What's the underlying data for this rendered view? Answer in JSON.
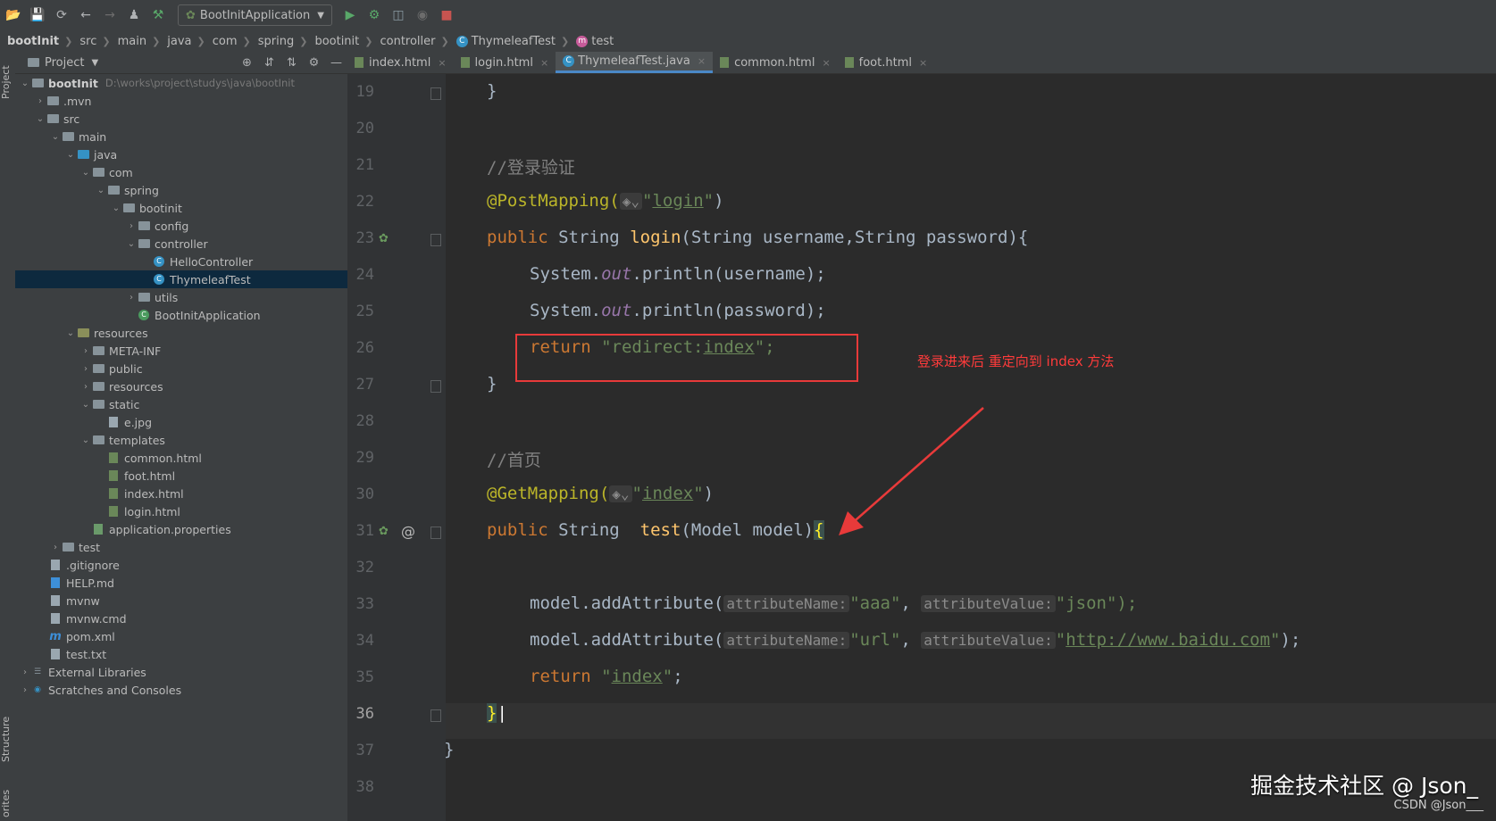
{
  "toolbar": {
    "run_config": "BootInitApplication"
  },
  "breadcrumbs": [
    "bootInit",
    "src",
    "main",
    "java",
    "com",
    "spring",
    "bootinit",
    "controller",
    "ThymeleafTest",
    "test"
  ],
  "project_panel": {
    "title": "Project",
    "root_name": "bootInit",
    "root_path": "D:\\works\\project\\studys\\java\\bootInit",
    "items": [
      ".mvn",
      "src",
      "main",
      "java",
      "com",
      "spring",
      "bootinit",
      "config",
      "controller",
      "HelloController",
      "ThymeleafTest",
      "utils",
      "BootInitApplication",
      "resources",
      "META-INF",
      "public",
      "resources",
      "static",
      "e.jpg",
      "templates",
      "common.html",
      "foot.html",
      "index.html",
      "login.html",
      "application.properties",
      "test",
      ".gitignore",
      "HELP.md",
      "mvnw",
      "mvnw.cmd",
      "pom.xml",
      "test.txt",
      "External Libraries",
      "Scratches and Consoles"
    ]
  },
  "left_strip": {
    "project": "Project",
    "structure": "Structure",
    "favorites": "orites"
  },
  "tabs": [
    "index.html",
    "login.html",
    "ThymeleafTest.java",
    "common.html",
    "foot.html"
  ],
  "editor": {
    "line_numbers": [
      "19",
      "20",
      "21",
      "22",
      "23",
      "24",
      "25",
      "26",
      "27",
      "28",
      "29",
      "30",
      "31",
      "32",
      "33",
      "34",
      "35",
      "36",
      "37",
      "38"
    ],
    "comment_login": "//登录验证",
    "comment_home": "//首页",
    "annotation_post": "@PostMapping(",
    "annotation_get": "@GetMapping(",
    "path_login": "login",
    "path_index": "index",
    "kw_public": "public",
    "type_string": "String",
    "method_login": "login",
    "params_login": "(String username,String password){",
    "sysout1_pre": "System.",
    "sysout_out": "out",
    "sysout1_post": ".println(username);",
    "sysout2_post": ".println(password);",
    "kw_return": "return",
    "redirect_prefix": "\"redirect:",
    "redirect_target": "index",
    "redirect_suffix": "\";",
    "method_test": "test",
    "params_test": "(Model model)",
    "model_add": "model.addAttribute(",
    "hint_name": "attributeName:",
    "hint_value": "attributeValue:",
    "attr_aaa": "\"aaa\"",
    "attr_json": "\"json\");",
    "attr_url": "\"url\"",
    "attr_baidu": "http://www.baidu.com",
    "return_index": "index",
    "brace_close": "}",
    "brace_open": "{"
  },
  "annotation_text": "登录进来后 重定向到 index 方法",
  "watermark": "掘金技术社区 @ Json_",
  "csdn": "CSDN @Json___",
  "colors": {
    "keyword": "#cc7832",
    "annotation": "#bbb529",
    "string": "#6a8759",
    "highlight_box": "#e83a3a"
  }
}
